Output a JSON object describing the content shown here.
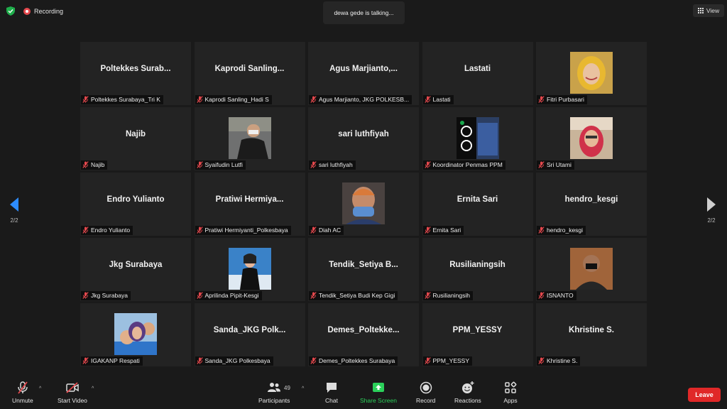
{
  "topbar": {
    "recording_label": "Recording",
    "talking_text": "dewa gede is talking...",
    "view_label": "View"
  },
  "nav": {
    "left_page": "2/2",
    "right_page": "2/2"
  },
  "participants": [
    {
      "big": "Poltekkes  Surab...",
      "label": "Poltekkes Surabaya_Tri K"
    },
    {
      "big": "Kaprodi  Sanling...",
      "label": "Kaprodi Sanling_Hadi S"
    },
    {
      "big": "Agus  Marjianto,...",
      "label": "Agus Marjianto, JKG POLKESB..."
    },
    {
      "big": "Lastati",
      "label": "Lastati"
    },
    {
      "big": "",
      "label": "Fitri Purbasari"
    },
    {
      "big": "Najib",
      "label": "Najib"
    },
    {
      "big": "",
      "label": "Syaifudin Lutfi"
    },
    {
      "big": "sari luthfiyah",
      "label": "sari luthfiyah"
    },
    {
      "big": "",
      "label": "Koordinator Penmas PPM"
    },
    {
      "big": "",
      "label": "Sri Utami"
    },
    {
      "big": "Endro Yulianto",
      "label": "Endro Yulianto"
    },
    {
      "big": "Pratiwi  Hermiya...",
      "label": "Pratiwi Hermiyanti_Polkesbaya"
    },
    {
      "big": "",
      "label": "Diah AC"
    },
    {
      "big": "Ernita Sari",
      "label": "Ernita Sari"
    },
    {
      "big": "hendro_kesgi",
      "label": "hendro_kesgi"
    },
    {
      "big": "Jkg Surabaya",
      "label": "Jkg Surabaya"
    },
    {
      "big": "",
      "label": "Aprilinda Pipit-Kesgi"
    },
    {
      "big": "Tendik_Setiya  B...",
      "label": "Tendik_Setiya Budi Kep Gigi"
    },
    {
      "big": "Rusilianingsih",
      "label": "Rusilianingsih"
    },
    {
      "big": "",
      "label": "ISNANTO"
    },
    {
      "big": "",
      "label": "IGAKANP Respati"
    },
    {
      "big": "Sanda_JKG  Polk...",
      "label": "Sanda_JKG Polkesbaya"
    },
    {
      "big": "Demes_Poltekke...",
      "label": "Demes_Poltekkes Surabaya"
    },
    {
      "big": "PPM_YESSY",
      "label": "PPM_YESSY"
    },
    {
      "big": "Khristine S.",
      "label": "Khristine S."
    }
  ],
  "toolbar": {
    "unmute": "Unmute",
    "start_video": "Start Video",
    "participants": "Participants",
    "participants_count": "49",
    "chat": "Chat",
    "share_screen": "Share Screen",
    "record": "Record",
    "reactions": "Reactions",
    "apps": "Apps",
    "leave": "Leave"
  },
  "icons": {
    "shield": "shield-check-icon",
    "mic_off": "microphone-off-icon",
    "video_off": "video-off-icon"
  },
  "colors": {
    "accent_blue": "#2d8cff",
    "share_green": "#2bd05a",
    "leave_red": "#e02828",
    "muted_red": "#e5484d"
  }
}
